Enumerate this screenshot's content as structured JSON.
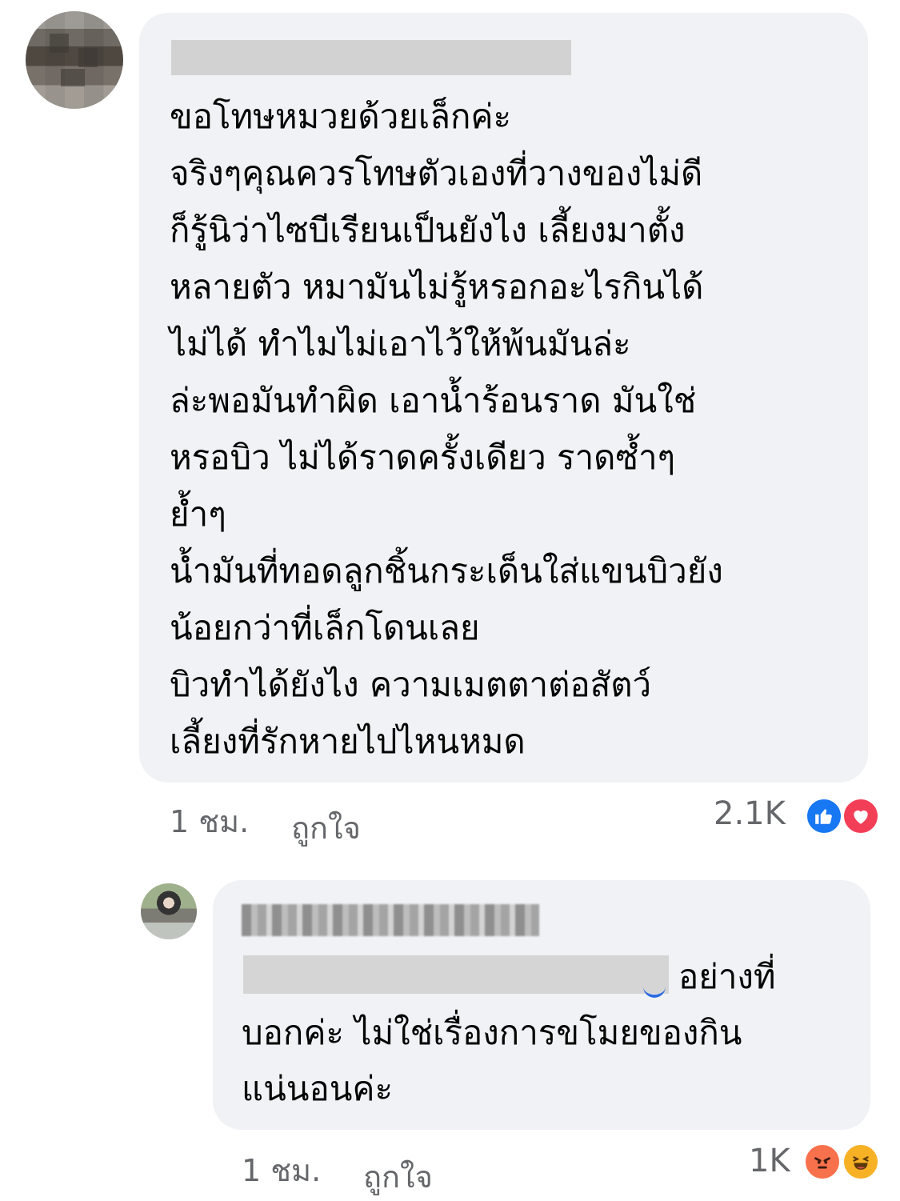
{
  "comment": {
    "text": "ขอโทษหมวยด้วยเล็กค่ะ\nจริงๆคุณควรโทษตัวเองที่วางของไม่ดี\nก็รู้นิว่าไซบีเรียนเป็นยังไง เลี้ยงมาตั้ง\nหลายตัว หมามันไม่รู้หรอกอะไรกินได้\nไม่ได้ ทำไมไม่เอาไว้ให้พ้นมันล่ะ\nล่ะพอมันทำผิด เอาน้ำร้อนราด มันใช่\nหรอบิว ไม่ได้ราดครั้งเดียว ราดซ้ำๆ\nย้ำๆ\nน้ำมันที่ทอดลูกชิ้นกระเด็นใส่แขนบิวยัง\nน้อยกว่าที่เล็กโดนเลย\nบิวทำได้ยังไง ความเมตตาต่อสัตว์\nเลี้ยงที่รักหายไปไหนหมด",
    "time": "1 ชม.",
    "like_label": "ถูกใจ",
    "reaction_count": "2.1K",
    "reactions": [
      "like-icon",
      "love-icon"
    ]
  },
  "reply": {
    "text_line1": "อย่างที่",
    "text_rest": "บอกค่ะ ไม่ใช่เรื่องการขโมยของกิน แน่นอนค่ะ",
    "time": "1 ชม.",
    "like_label": "ถูกใจ",
    "reaction_count": "1K",
    "reactions": [
      "angry-icon",
      "haha-icon"
    ]
  },
  "colors": {
    "bubble": "#f0f2f5",
    "meta_text": "#65676b",
    "like": "#1877f2",
    "love": "#f33e58",
    "angry": "#f7714c",
    "haha": "#f7b125"
  }
}
